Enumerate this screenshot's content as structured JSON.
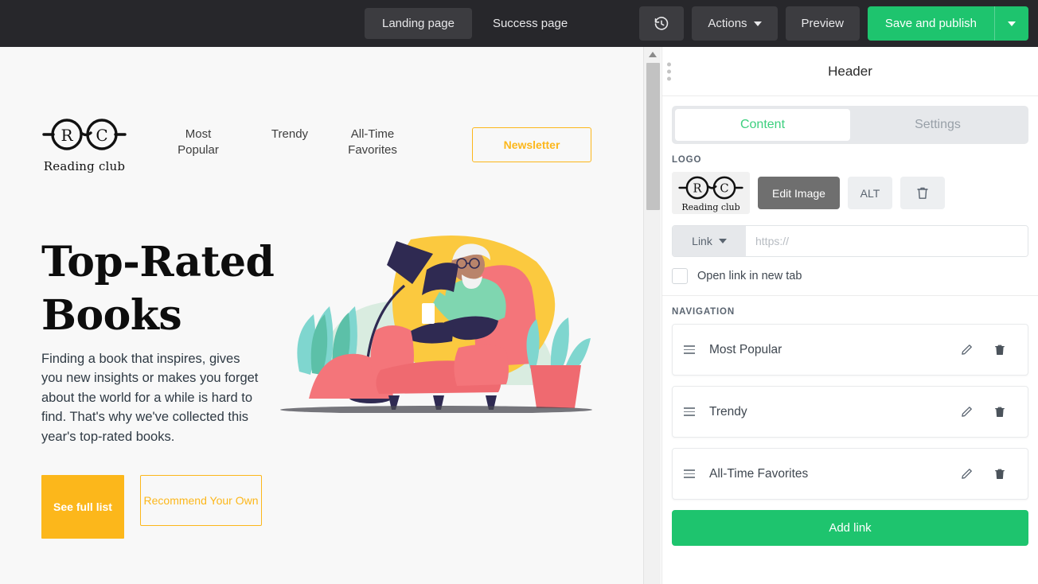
{
  "toolbar": {
    "pages": [
      {
        "label": "Landing page",
        "active": true
      },
      {
        "label": "Success page",
        "active": false
      }
    ],
    "history_icon": "history-clock-icon",
    "actions_label": "Actions",
    "preview_label": "Preview",
    "publish_label": "Save and publish",
    "publish_caret_icon": "chevron-down-icon",
    "accent_green": "#1ec46e",
    "background": "#27272b"
  },
  "site": {
    "logo": {
      "left_letter": "R",
      "right_letter": "C",
      "wordmark": "Reading club"
    },
    "nav": [
      {
        "label": "Most Popular"
      },
      {
        "label": "Trendy"
      },
      {
        "label": "All-Time Favorites"
      }
    ],
    "newsletter_label": "Newsletter",
    "hero": {
      "title": "Top-Rated Books",
      "body": "Finding a book that inspires, gives you new insights or makes you forget about the world for a while is hard to find. That's why we've collected this year's top-rated books.",
      "primary_button": "See full list",
      "secondary_button": "Recommend Your Own"
    },
    "illustration": "person-reading-in-armchair-illustration",
    "amber": "#fcb71b",
    "background": "#f8f8f8"
  },
  "panel": {
    "title": "Header",
    "drag_handle_icon": "drag-dots-icon",
    "tabs": [
      {
        "label": "Content",
        "active": true
      },
      {
        "label": "Settings",
        "active": false
      }
    ],
    "logo_section": {
      "label": "LOGO",
      "thumb_left_letter": "R",
      "thumb_right_letter": "C",
      "thumb_wordmark": "Reading club",
      "edit_image_label": "Edit Image",
      "alt_label": "ALT",
      "delete_icon": "trash-icon"
    },
    "link_row": {
      "select_label": "Link",
      "select_caret_icon": "chevron-down-icon",
      "input_value": "",
      "input_placeholder": "https://"
    },
    "new_tab_checkbox": {
      "label": "Open link in new tab",
      "checked": false
    },
    "navigation_section": {
      "label": "NAVIGATION",
      "items": [
        {
          "label": "Most Popular",
          "handle_icon": "drag-handle-icon",
          "edit_icon": "pencil-icon",
          "delete_icon": "trash-icon"
        },
        {
          "label": "Trendy",
          "handle_icon": "drag-handle-icon",
          "edit_icon": "pencil-icon",
          "delete_icon": "trash-icon"
        },
        {
          "label": "All-Time Favorites",
          "handle_icon": "drag-handle-icon",
          "edit_icon": "pencil-icon",
          "delete_icon": "trash-icon"
        }
      ],
      "add_link_label": "Add link"
    }
  },
  "scrollbar": {
    "up_arrow_icon": "triangle-up-icon"
  }
}
